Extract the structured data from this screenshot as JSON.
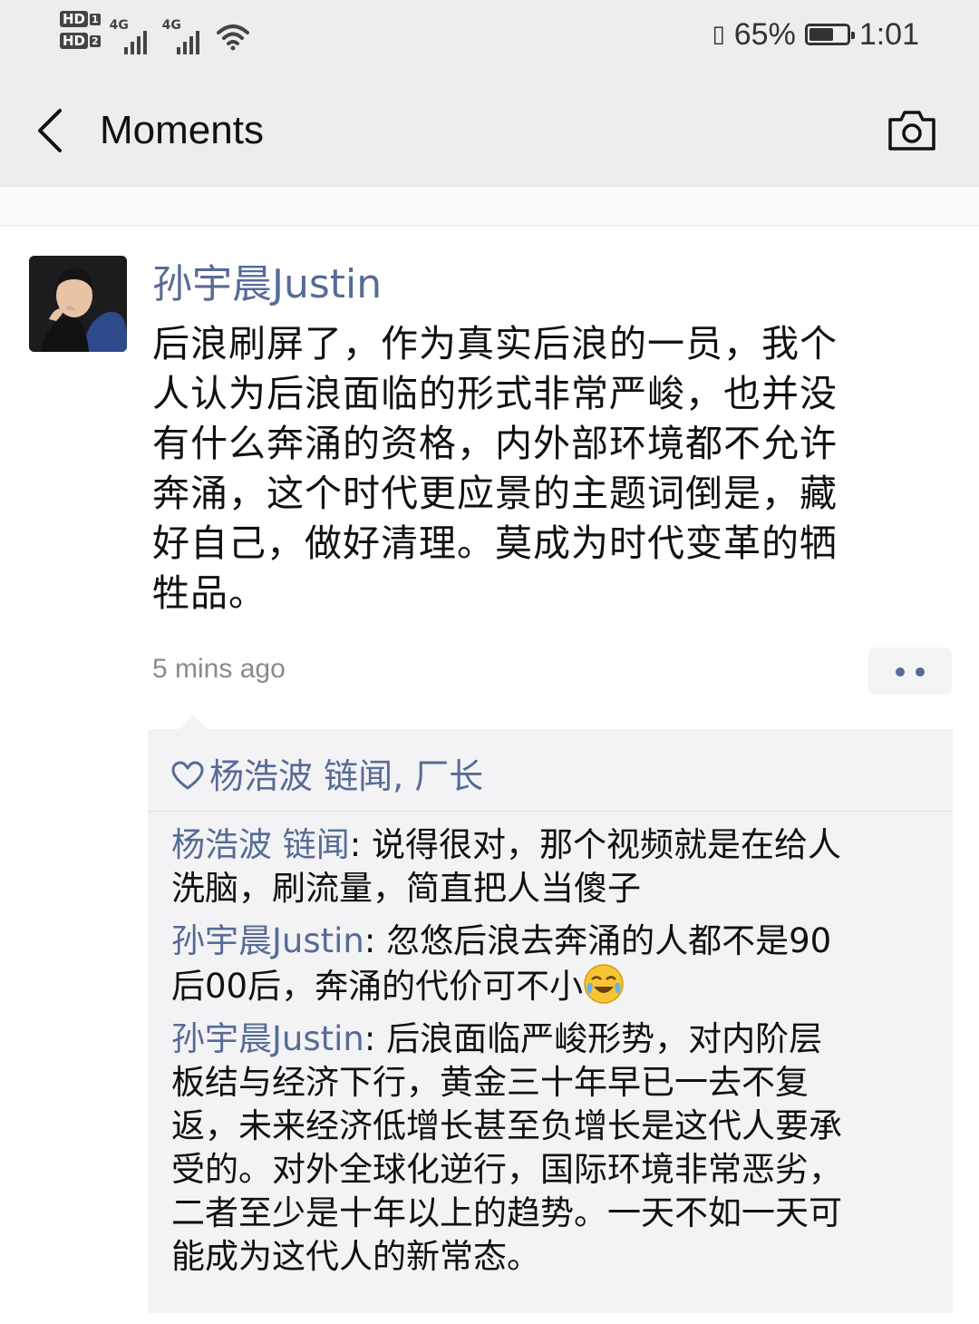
{
  "status_bar": {
    "sim1_label": "HD",
    "sim1_num": "1",
    "sim2_label": "HD",
    "sim2_num": "2",
    "network1": "4G",
    "network2": "4G",
    "battery_percent": "65%",
    "battery_level": 0.65,
    "time": "1:01"
  },
  "nav": {
    "title": "Moments",
    "back_icon": "chevron-left-icon",
    "camera_icon": "camera-icon"
  },
  "post": {
    "author": "孙宇晨Justin",
    "text": "后浪刷屏了，作为真实后浪的一员，我个\n人认为后浪面临的形式非常严峻，也并没\n有什么奔涌的资格，内外部环境都不允许\n奔涌，这个时代更应景的主题词倒是，藏\n好自己，做好清理。莫成为时代变革的牺\n牲品。",
    "timestamp": "5 mins ago",
    "more_icon": "more-dots-icon"
  },
  "likes": {
    "icon": "heart-icon",
    "names": "杨浩波 链闻, 厂长"
  },
  "comments": [
    {
      "author": "杨浩波 链闻",
      "separator": ": ",
      "text": "说得很对，那个视频就是在给人\n洗脑，刷流量，简直把人当傻子"
    },
    {
      "author": "孙宇晨Justin",
      "separator": ": ",
      "text": "忽悠后浪去奔涌的人都不是90\n后00后，奔涌的代价可不小",
      "emoji": "crying-laughing-emoji"
    },
    {
      "author": "孙宇晨Justin",
      "separator": ": ",
      "text": "后浪面临严峻形势，对内阶层\n板结与经济下行，黄金三十年早已一去不复\n返，未来经济低增长甚至负增长是这代人要承\n受的。对外全球化逆行，国际环境非常恶劣，\n二者至少是十年以上的趋势。一天不如一天可\n能成为这代人的新常态。"
    }
  ],
  "colors": {
    "link_blue": "#576b95",
    "bar_bg": "#ededed",
    "comment_bg": "#f3f3f5"
  }
}
